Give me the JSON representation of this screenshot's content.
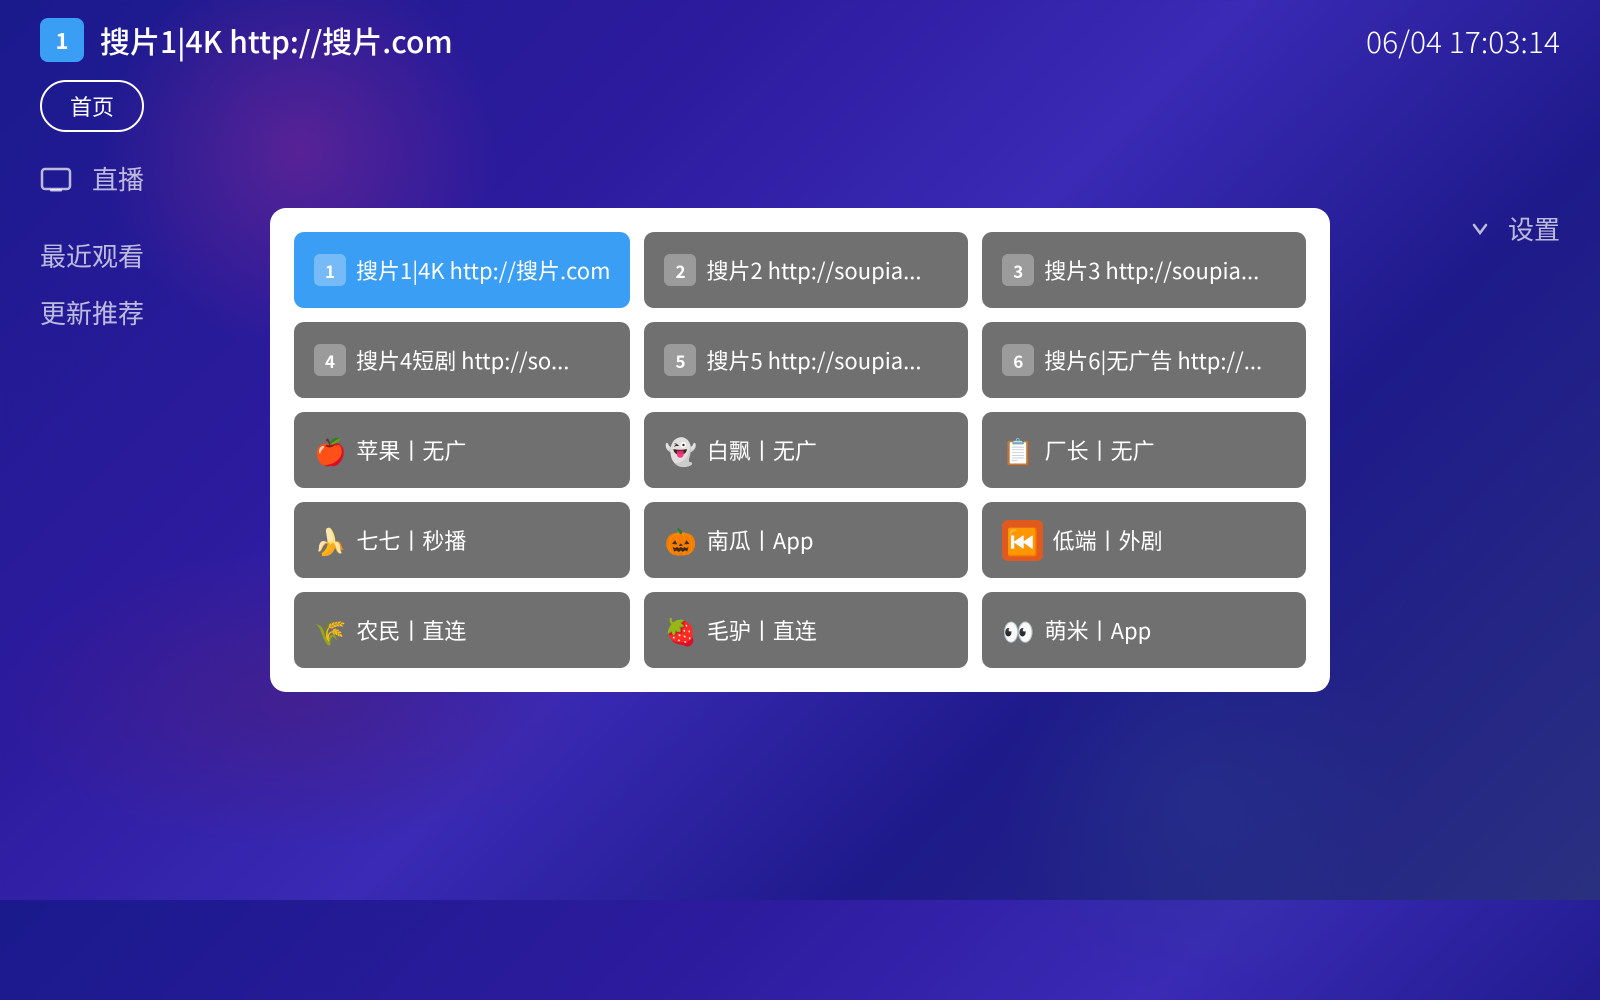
{
  "header": {
    "channel_number": "1",
    "channel_title": "搜片1|4K http://搜片.com",
    "time": "06/04 17:03:14"
  },
  "home_button": "首页",
  "bg_labels": {
    "live": "直播",
    "recent": "最近观看",
    "recommended": "更新推荐",
    "settings": "设置"
  },
  "sources": [
    {
      "id": 1,
      "emoji": "",
      "number": "1",
      "label": "搜片1|4K http://搜片.com",
      "active": true,
      "has_badge": true
    },
    {
      "id": 2,
      "emoji": "",
      "number": "2",
      "label": "搜片2 http://soupia...",
      "active": false,
      "has_badge": true
    },
    {
      "id": 3,
      "emoji": "",
      "number": "3",
      "label": "搜片3 http://soupia...",
      "active": false,
      "has_badge": true
    },
    {
      "id": 4,
      "emoji": "",
      "number": "4",
      "label": "搜片4短剧 http://so...",
      "active": false,
      "has_badge": true
    },
    {
      "id": 5,
      "emoji": "",
      "number": "5",
      "label": "搜片5 http://soupia...",
      "active": false,
      "has_badge": true
    },
    {
      "id": 6,
      "emoji": "",
      "number": "6",
      "label": "搜片6|无广告 http://...",
      "active": false,
      "has_badge": true
    },
    {
      "id": 7,
      "emoji": "🍎",
      "number": null,
      "label": "苹果丨无广",
      "active": false,
      "has_badge": false
    },
    {
      "id": 8,
      "emoji": "👻",
      "number": null,
      "label": "白飘丨无广",
      "active": false,
      "has_badge": false
    },
    {
      "id": 9,
      "emoji": "📋",
      "number": null,
      "label": "厂长丨无广",
      "active": false,
      "has_badge": false
    },
    {
      "id": 10,
      "emoji": "🍌",
      "number": null,
      "label": "七七丨秒播",
      "active": false,
      "has_badge": false
    },
    {
      "id": 11,
      "emoji": "🎃",
      "number": null,
      "label": "南瓜丨App",
      "active": false,
      "has_badge": false
    },
    {
      "id": 12,
      "emoji": "⏮️",
      "number": null,
      "label": "低端丨外剧",
      "active": false,
      "has_badge": false,
      "emoji_bg": "#e05a20"
    },
    {
      "id": 13,
      "emoji": "🌾",
      "number": null,
      "label": "农民丨直连",
      "active": false,
      "has_badge": false
    },
    {
      "id": 14,
      "emoji": "🍓",
      "number": null,
      "label": "毛驴丨直连",
      "active": false,
      "has_badge": false
    },
    {
      "id": 15,
      "emoji": "👀",
      "number": null,
      "label": "萌米丨App",
      "active": false,
      "has_badge": false
    }
  ],
  "badge_colors": {
    "1": "#3b9ef5",
    "2": "#3b9ef5",
    "3": "#3b9ef5",
    "4": "#3b9ef5",
    "5": "#3b9ef5",
    "6": "#3b9ef5"
  }
}
